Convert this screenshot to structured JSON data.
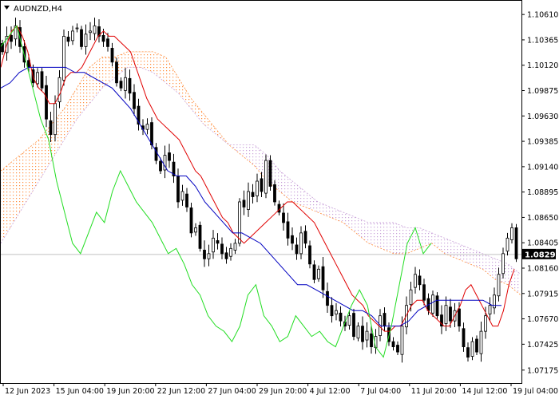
{
  "window": {
    "title": "AUDNZD,H4",
    "menu_icon": "triangle-down-icon"
  },
  "price_tag": "1.08292",
  "colors": {
    "background": "#ffffff",
    "axis": "#000000",
    "candle": "#000000",
    "tenkan": "#e00000",
    "kijun": "#0000c0",
    "chikou": "#22dd22",
    "kumo_bull": "#ff8c3a",
    "kumo_bear": "#c8a0d8",
    "price_line": "#c0c0c0",
    "price_tag_bg": "#000000"
  },
  "chart_data": {
    "type": "candlestick",
    "instrument": "AUDNZD",
    "timeframe": "H4",
    "indicator": "Ichimoku Kinko Hyo",
    "ylim": [
      1.0705,
      1.1075
    ],
    "y_ticks": [
      "1.10610",
      "1.10365",
      "1.10120",
      "1.09875",
      "1.09630",
      "1.09385",
      "1.09140",
      "1.08895",
      "1.08650",
      "1.08405",
      "1.08160",
      "1.07915",
      "1.07670",
      "1.07425",
      "1.07175"
    ],
    "x_ticks": [
      "12 Jun 2023",
      "15 Jun 04:00",
      "19 Jun 20:00",
      "22 Jun 12:00",
      "27 Jun 04:00",
      "29 Jun 20:00",
      "4 Jul 12:00",
      "7 Jul 04:00",
      "11 Jul 20:00",
      "14 Jul 12:00",
      "19 Jul 04:00"
    ],
    "last_price": 1.08292,
    "closes": [
      1.1025,
      1.104,
      1.1035,
      1.105,
      1.103,
      1.1015,
      1.101,
      1.0995,
      1.1005,
      1.099,
      1.096,
      1.0945,
      1.0975,
      1.1,
      1.104,
      1.1035,
      1.1045,
      1.1048,
      1.103,
      1.1042,
      1.1045,
      1.105,
      1.104,
      1.1035,
      1.103,
      1.1015,
      1.0995,
      1.099,
      1.1,
      1.0985,
      1.097,
      1.0955,
      1.095,
      1.0955,
      1.0935,
      1.092,
      1.091,
      1.0925,
      1.092,
      1.0905,
      1.088,
      1.089,
      1.0875,
      1.085,
      1.0855,
      1.0835,
      1.0825,
      1.083,
      1.0845,
      1.084,
      1.083,
      1.0825,
      1.0835,
      1.084,
      1.088,
      1.0875,
      1.089,
      1.0885,
      1.09,
      1.089,
      1.092,
      1.0895,
      1.088,
      1.087,
      1.086,
      1.0845,
      1.084,
      1.083,
      1.085,
      1.084,
      1.082,
      1.0805,
      1.0815,
      1.0795,
      1.078,
      1.077,
      1.0775,
      1.0765,
      1.076,
      1.077,
      1.075,
      1.076,
      1.0745,
      1.0755,
      1.074,
      1.075,
      1.077,
      1.076,
      1.0745,
      1.074,
      1.0735,
      1.076,
      1.078,
      1.0795,
      1.081,
      1.08,
      1.0785,
      1.0775,
      1.079,
      1.077,
      1.076,
      1.078,
      1.0765,
      1.0775,
      1.076,
      1.074,
      1.073,
      1.0745,
      1.0735,
      1.0755,
      1.077,
      1.078,
      1.079,
      1.081,
      1.083,
      1.0845,
      1.0855,
      1.0825
    ],
    "series": [
      {
        "key": "tenkan",
        "values": [
          1.101,
          1.103,
          1.1045,
          1.105,
          1.104,
          1.1025,
          1.1,
          1.099,
          1.0985,
          1.0975,
          1.0975,
          1.0985,
          1.1,
          1.1005,
          1.1005,
          1.101,
          1.102,
          1.103,
          1.104,
          1.1045,
          1.104,
          1.104,
          1.1035,
          1.103,
          1.1025,
          1.101,
          1.0995,
          1.098,
          1.097,
          1.096,
          1.0955,
          1.095,
          1.0945,
          1.094,
          1.093,
          1.092,
          1.091,
          1.0905,
          1.0895,
          1.0885,
          1.0875,
          1.0865,
          1.086,
          1.085,
          1.0845,
          1.084,
          1.0845,
          1.085,
          1.0855,
          1.086,
          1.0865,
          1.087,
          1.0875,
          1.088,
          1.088,
          1.0875,
          1.087,
          1.0865,
          1.086,
          1.085,
          1.084,
          1.083,
          1.082,
          1.081,
          1.08,
          1.079,
          1.0785,
          1.078,
          1.077,
          1.0765,
          1.076,
          1.0755,
          1.0755,
          1.076,
          1.076,
          1.077,
          1.078,
          1.0785,
          1.0785,
          1.0775,
          1.077,
          1.0765,
          1.076,
          1.076,
          1.077,
          1.078,
          1.0795,
          1.08,
          1.079,
          1.078,
          1.077,
          1.076,
          1.076,
          1.0775,
          1.08,
          1.0815
        ]
      },
      {
        "key": "kijun",
        "values": [
          1.099,
          1.0995,
          1.1005,
          1.101,
          1.101,
          1.101,
          1.101,
          1.101,
          1.1005,
          1.1005,
          1.1,
          1.0995,
          1.099,
          1.098,
          1.097,
          1.0955,
          1.094,
          1.0925,
          1.091,
          1.0905,
          1.0905,
          1.0895,
          1.088,
          1.087,
          1.086,
          1.085,
          1.085,
          1.0845,
          1.084,
          1.083,
          1.082,
          1.081,
          1.08,
          1.08,
          1.0795,
          1.079,
          1.0785,
          1.078,
          1.0775,
          1.0775,
          1.077,
          1.076,
          1.076,
          1.076,
          1.0765,
          1.0775,
          1.078,
          1.0785,
          1.0785,
          1.0785,
          1.0785,
          1.0785,
          1.0785,
          1.078,
          1.078
        ]
      },
      {
        "key": "chikou",
        "values": [
          1.103,
          1.104,
          1.105,
          1.102,
          1.099,
          1.096,
          1.094,
          1.09,
          1.087,
          1.084,
          1.083,
          1.085,
          1.087,
          1.086,
          1.089,
          1.091,
          1.0895,
          1.088,
          1.087,
          1.086,
          1.0845,
          1.083,
          1.0835,
          1.082,
          1.08,
          1.079,
          1.077,
          1.076,
          1.0755,
          1.0745,
          1.076,
          1.079,
          1.08,
          1.077,
          1.076,
          1.0745,
          1.075,
          1.077,
          1.076,
          1.075,
          1.0755,
          1.0745,
          1.074,
          1.076,
          1.078,
          1.0795,
          1.078,
          1.074,
          1.073,
          1.076,
          1.08,
          1.084,
          1.0855,
          1.083,
          1.084
        ]
      },
      {
        "key": "span_a",
        "values": [
          1.091,
          1.092,
          1.093,
          1.094,
          1.0955,
          1.097,
          1.099,
          1.101,
          1.102,
          1.102,
          1.1025,
          1.1025,
          1.1025,
          1.102,
          1.1,
          1.098,
          1.0965,
          1.095,
          1.0935,
          1.0925,
          1.0915,
          1.09,
          1.089,
          1.088,
          1.0875,
          1.087,
          1.0865,
          1.086,
          1.085,
          1.084,
          1.0835,
          1.083,
          1.083,
          1.0835,
          1.084,
          1.083,
          1.0825,
          1.082,
          1.0815,
          1.0805,
          1.08,
          1.079
        ]
      },
      {
        "key": "span_b",
        "values": [
          1.084,
          1.086,
          1.088,
          1.09,
          1.092,
          1.094,
          1.096,
          1.0975,
          1.099,
          1.1,
          1.101,
          1.101,
          1.1005,
          1.0995,
          1.0985,
          1.097,
          1.0955,
          1.0945,
          1.0935,
          1.0935,
          1.0935,
          1.0925,
          1.091,
          1.09,
          1.089,
          1.088,
          1.0875,
          1.087,
          1.0865,
          1.086,
          1.086,
          1.086,
          1.0855,
          1.0855,
          1.085,
          1.0845,
          1.084,
          1.0835,
          1.083,
          1.0825,
          1.082,
          1.081
        ]
      }
    ]
  }
}
